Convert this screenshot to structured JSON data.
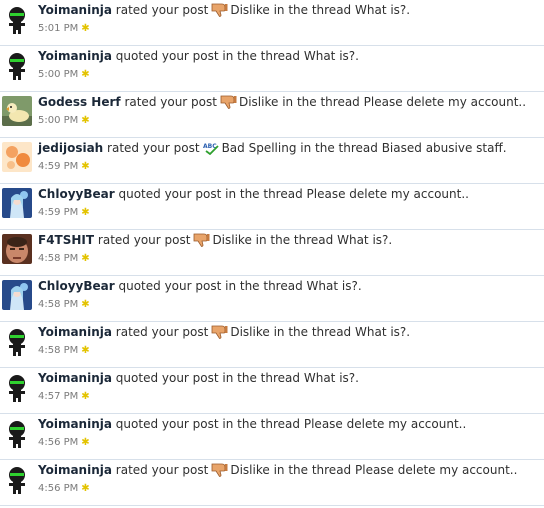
{
  "notifications": [
    {
      "user": "Yoimaninja",
      "avatar": "ninja",
      "action": "rated your post",
      "rating": {
        "icon": "thumbs-down-icon",
        "label": "Dislike"
      },
      "connector": "in the thread",
      "thread": "What is?.",
      "time": "5:01 PM"
    },
    {
      "user": "Yoimaninja",
      "avatar": "ninja",
      "action": "quoted your post",
      "rating": null,
      "connector": "in the thread",
      "thread": "What is?.",
      "time": "5:00 PM"
    },
    {
      "user": "Godess Herf",
      "avatar": "duck",
      "action": "rated your post",
      "rating": {
        "icon": "thumbs-down-icon",
        "label": "Dislike"
      },
      "connector": "in the thread",
      "thread": "Please delete my account..",
      "time": "5:00 PM"
    },
    {
      "user": "jedijosiah",
      "avatar": "orange",
      "action": "rated your post",
      "rating": {
        "icon": "abc-spellcheck-icon",
        "label": "Bad Spelling"
      },
      "connector": "in the thread",
      "thread": "Biased abusive staff.",
      "time": "4:59 PM"
    },
    {
      "user": "ChloyyBear",
      "avatar": "anime",
      "action": "quoted your post",
      "rating": null,
      "connector": "in the thread",
      "thread": "Please delete my account..",
      "time": "4:59 PM"
    },
    {
      "user": "F4TSHIT",
      "avatar": "face",
      "action": "rated your post",
      "rating": {
        "icon": "thumbs-down-icon",
        "label": "Dislike"
      },
      "connector": "in the thread",
      "thread": "What is?.",
      "time": "4:58 PM"
    },
    {
      "user": "ChloyyBear",
      "avatar": "anime",
      "action": "quoted your post",
      "rating": null,
      "connector": "in the thread",
      "thread": "What is?.",
      "time": "4:58 PM"
    },
    {
      "user": "Yoimaninja",
      "avatar": "ninja",
      "action": "rated your post",
      "rating": {
        "icon": "thumbs-down-icon",
        "label": "Dislike"
      },
      "connector": "in the thread",
      "thread": "What is?.",
      "time": "4:58 PM"
    },
    {
      "user": "Yoimaninja",
      "avatar": "ninja",
      "action": "quoted your post",
      "rating": null,
      "connector": "in the thread",
      "thread": "What is?.",
      "time": "4:57 PM"
    },
    {
      "user": "Yoimaninja",
      "avatar": "ninja",
      "action": "quoted your post",
      "rating": null,
      "connector": "in the thread",
      "thread": "Please delete my account..",
      "time": "4:56 PM"
    },
    {
      "user": "Yoimaninja",
      "avatar": "ninja",
      "action": "rated your post",
      "rating": {
        "icon": "thumbs-down-icon",
        "label": "Dislike"
      },
      "connector": "in the thread",
      "thread": "Please delete my account..",
      "time": "4:56 PM"
    }
  ],
  "colors": {
    "divider": "#d7e0ea",
    "username": "#1b2838",
    "time": "#7a7a7a",
    "star": "#e3c300"
  }
}
